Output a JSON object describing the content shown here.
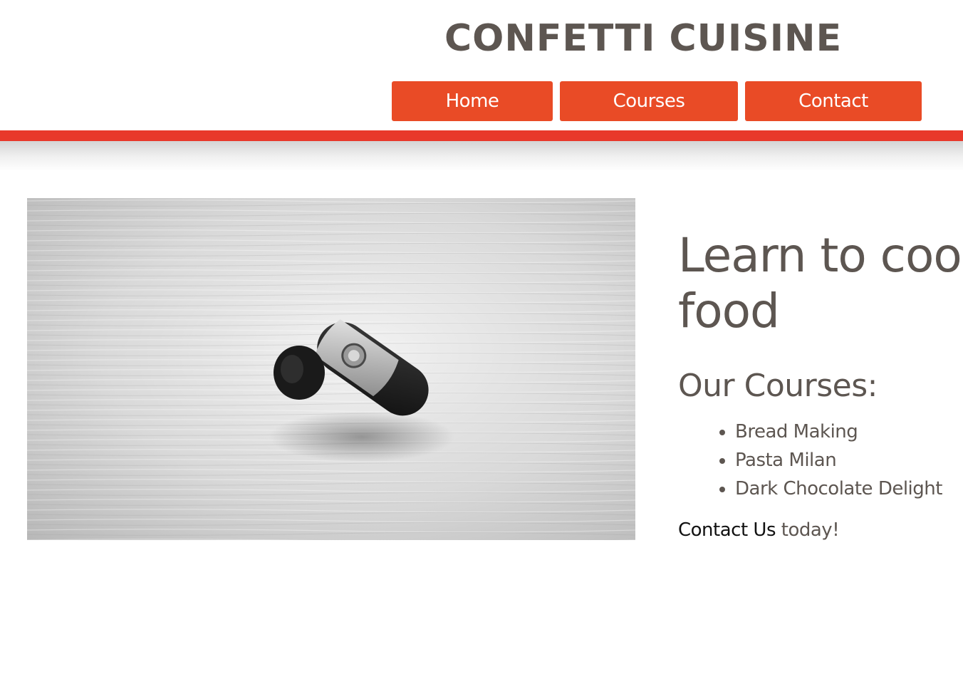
{
  "header": {
    "title": "CONFETTI CUISINE",
    "nav": [
      {
        "label": "Home"
      },
      {
        "label": "Courses"
      },
      {
        "label": "Contact"
      }
    ],
    "accent_color": "#e94b26"
  },
  "main": {
    "image": {
      "depicts": "bluetooth-headset-on-wood-table"
    },
    "headline_line1": "Learn to coo",
    "headline_line2": "food",
    "courses_heading": "Our Courses:",
    "courses": [
      "Bread Making",
      "Pasta Milan",
      "Dark Chocolate Delight"
    ],
    "contact_link": "Contact Us",
    "contact_suffix": " today!"
  }
}
